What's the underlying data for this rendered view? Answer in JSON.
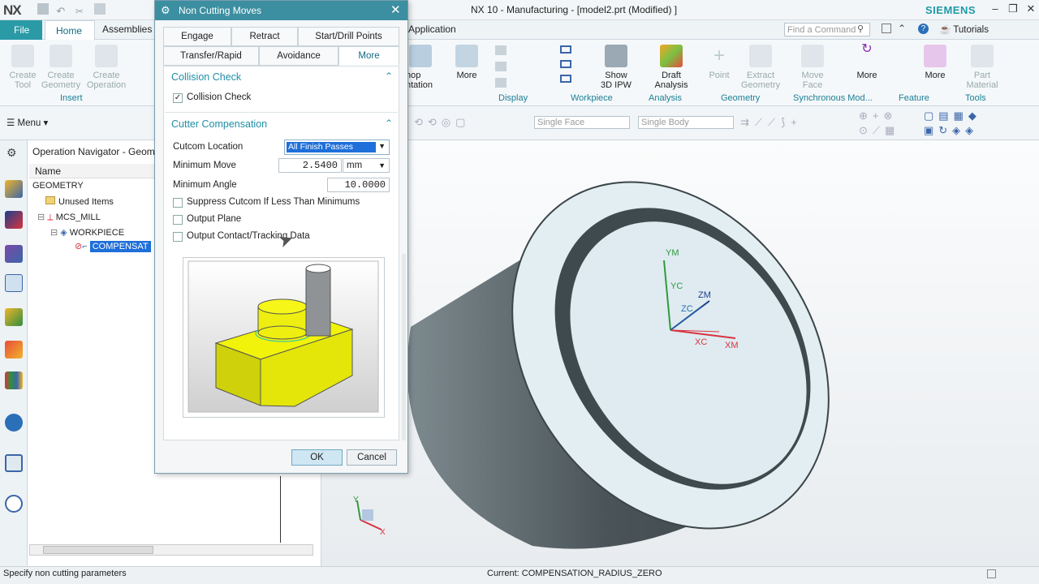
{
  "app": {
    "logo": "NX",
    "title": "NX 10 - Manufacturing - [model2.prt (Modified) ]",
    "brand": "SIEMENS"
  },
  "ribbon_tabs": {
    "file": "File",
    "home": "Home",
    "assemblies": "Assemblies",
    "application": "Application",
    "search_placeholder": "Find a Command",
    "tutorials": "Tutorials"
  },
  "ribbon": {
    "create_tool": "Create\nTool",
    "create_geometry": "Create\nGeometry",
    "create_operation": "Create\nOperation",
    "insert": "Insert",
    "shop_doc": "hop\nntation",
    "more1": "More",
    "display": "Display",
    "show_ipw": "Show\n3D IPW",
    "workpiece": "Workpiece",
    "draft": "Draft\nAnalysis",
    "analysis": "Analysis",
    "point": "Point",
    "extract": "Extract\nGeometry",
    "geometry": "Geometry",
    "move_face": "Move\nFace",
    "more2": "More",
    "sync": "Synchronous Mod...",
    "more3": "More",
    "feature": "Feature",
    "part_material": "Part\nMaterial",
    "tools": "Tools"
  },
  "selbar": {
    "menu": "Menu",
    "face_filter": "Single Face",
    "body_filter": "Single Body"
  },
  "navigator": {
    "title": "Operation Navigator - Geomet",
    "col_name": "Name",
    "items": [
      "GEOMETRY",
      "Unused Items",
      "MCS_MILL",
      "WORKPIECE",
      "COMPENSAT"
    ]
  },
  "dialog": {
    "title": "Non Cutting Moves",
    "tabs": [
      "Engage",
      "Retract",
      "Start/Drill Points",
      "Transfer/Rapid",
      "Avoidance",
      "More"
    ],
    "collision_section": "Collision Check",
    "collision_check": "Collision Check",
    "cutter_section": "Cutter Compensation",
    "cutcom_label": "Cutcom Location",
    "cutcom_value": "All Finish Passes",
    "min_move_label": "Minimum Move",
    "min_move_value": "2.5400",
    "min_move_unit": "mm",
    "min_angle_label": "Minimum Angle",
    "min_angle_value": "10.0000",
    "suppress": "Suppress Cutcom If Less Than Minimums",
    "output_plane": "Output Plane",
    "output_contact": "Output Contact/Tracking Data",
    "ok": "OK",
    "cancel": "Cancel"
  },
  "viewport": {
    "labels": {
      "ym": "YM",
      "yc": "YC",
      "zm": "ZM",
      "zc": "ZC",
      "xc": "XC",
      "xm": "XM",
      "tri_y": "Y",
      "tri_x": "X"
    }
  },
  "status": {
    "prompt": "Specify non cutting parameters",
    "current": "Current: COMPENSATION_RADIUS_ZERO"
  },
  "colors": {
    "accent": "#2a9aa6",
    "dialog_title": "#3c8fa0",
    "selection": "#1e6fd9",
    "part": "#f1f30a"
  }
}
